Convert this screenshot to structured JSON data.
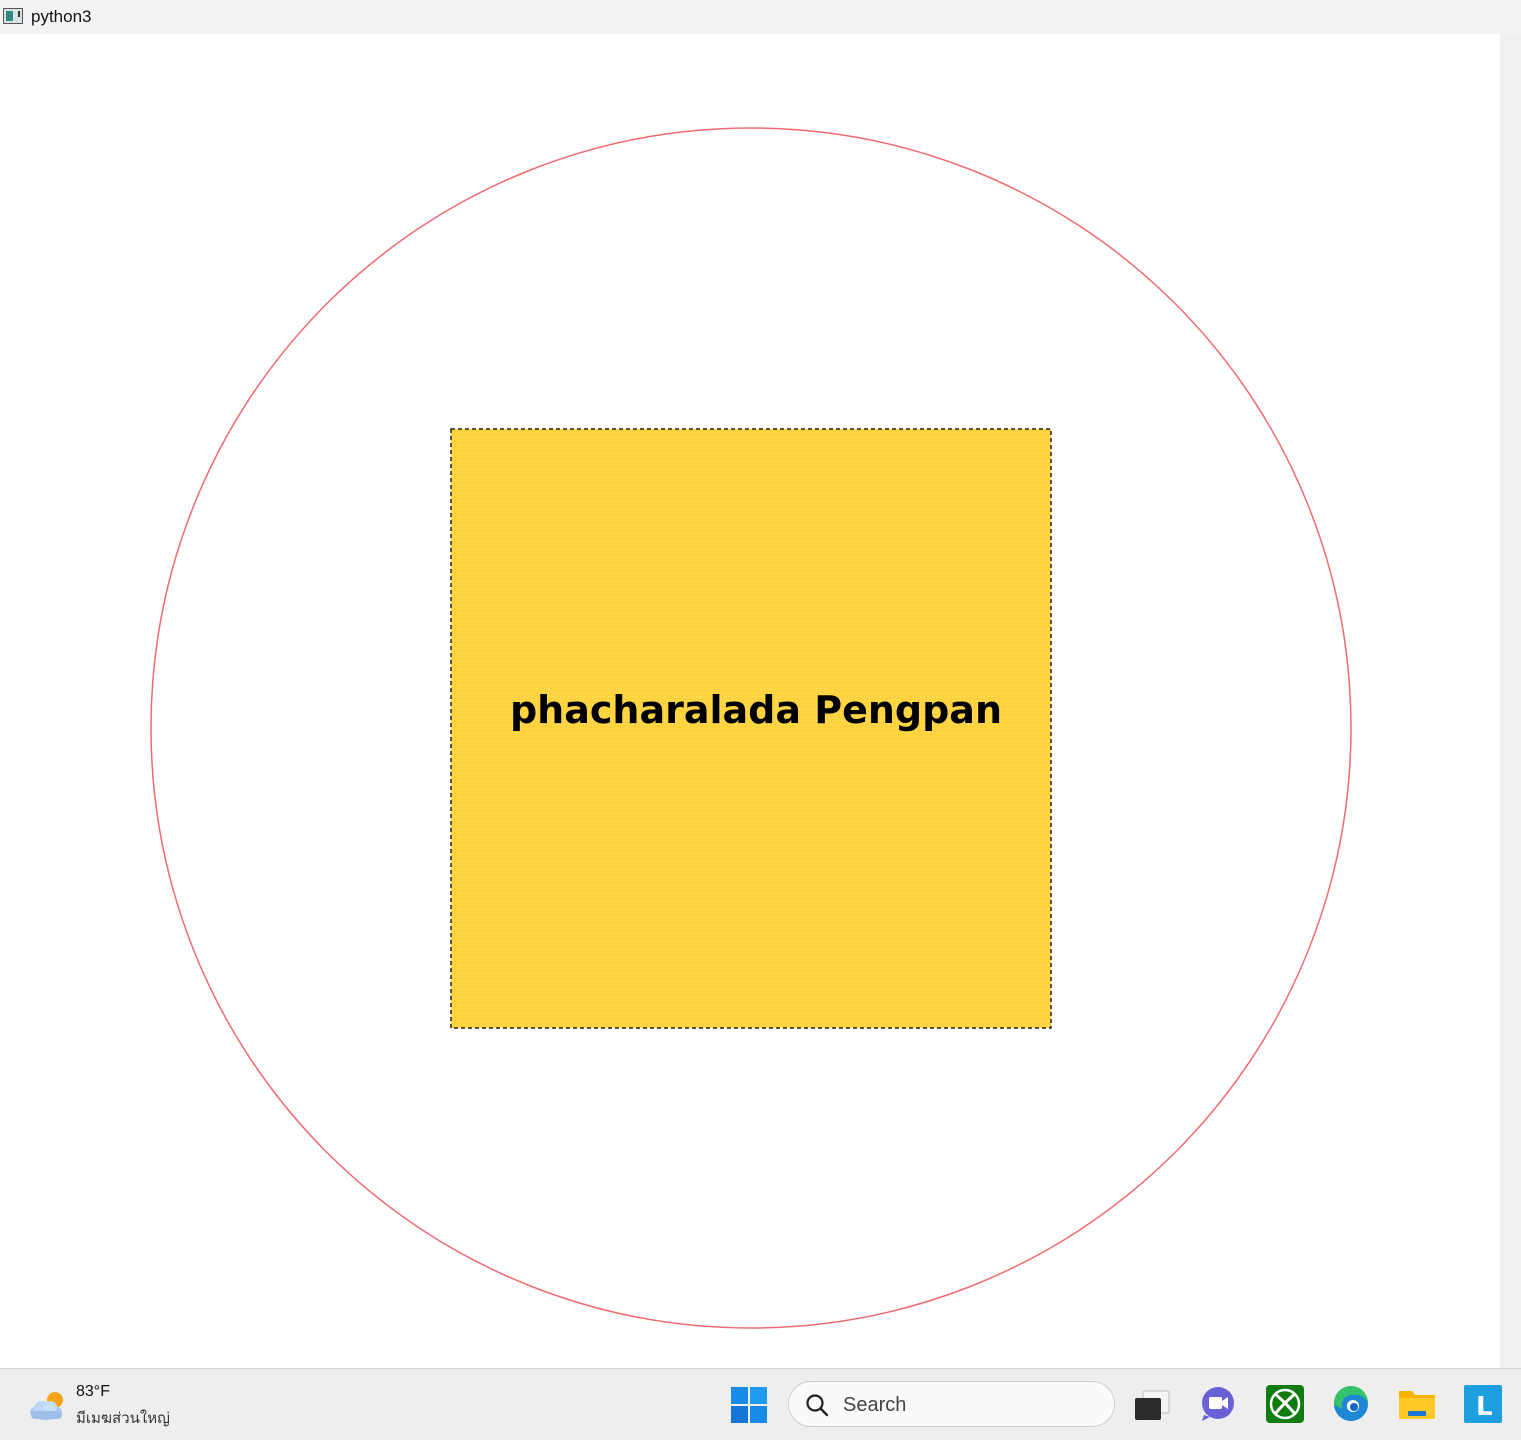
{
  "window": {
    "title": "python3"
  },
  "canvas": {
    "circle_color": "#f06a73",
    "square_fill": "#ffd33d",
    "square_border": "#222222",
    "label": "phacharalada Pengpan"
  },
  "taskbar": {
    "weather": {
      "temperature": "83°F",
      "description": "มีเมฆส่วนใหญ่",
      "icon": "partly-cloudy-icon"
    },
    "search": {
      "placeholder": "Search"
    },
    "pinned": [
      {
        "name": "start-button",
        "icon": "windows-logo-icon"
      },
      {
        "name": "task-view-button",
        "icon": "task-view-icon"
      },
      {
        "name": "teams-chat-button",
        "icon": "video-chat-icon"
      },
      {
        "name": "xbox-button",
        "icon": "xbox-icon"
      },
      {
        "name": "edge-button",
        "icon": "edge-browser-icon"
      },
      {
        "name": "file-explorer-button",
        "icon": "folder-icon"
      },
      {
        "name": "app-l-button",
        "icon": "letter-l-icon"
      }
    ],
    "app_l_letter": "L"
  }
}
